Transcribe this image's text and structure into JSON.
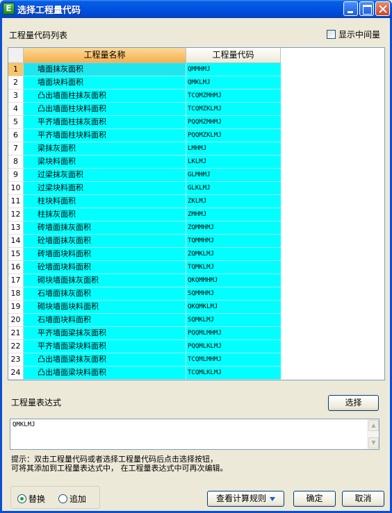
{
  "window": {
    "title": "选择工程量代码"
  },
  "list_label": "工程量代码列表",
  "show_intermediate_label": "显示中间量",
  "table": {
    "headers": {
      "name": "工程量名称",
      "code": "工程量代码"
    },
    "rows": [
      {
        "n": "1",
        "name": "墙面抹灰面积",
        "code": "QMMHMJ"
      },
      {
        "n": "2",
        "name": "墙面块料面积",
        "code": "QMKLMJ"
      },
      {
        "n": "3",
        "name": "凸出墙面柱抹灰面积",
        "code": "TCQMZMHMJ"
      },
      {
        "n": "4",
        "name": "凸出墙面柱块料面积",
        "code": "TCQMZKLMJ"
      },
      {
        "n": "5",
        "name": "平齐墙面柱抹灰面积",
        "code": "PQQMZMHMJ"
      },
      {
        "n": "6",
        "name": "平齐墙面柱块料面积",
        "code": "PQQMZKLMJ"
      },
      {
        "n": "7",
        "name": "梁抹灰面积",
        "code": "LMHMJ"
      },
      {
        "n": "8",
        "name": "梁块料面积",
        "code": "LKLMJ"
      },
      {
        "n": "9",
        "name": "过梁抹灰面积",
        "code": "GLMHMJ"
      },
      {
        "n": "10",
        "name": "过梁块料面积",
        "code": "GLKLMJ"
      },
      {
        "n": "11",
        "name": "柱块料面积",
        "code": "ZKLMJ"
      },
      {
        "n": "12",
        "name": "柱抹灰面积",
        "code": "ZMHMJ"
      },
      {
        "n": "13",
        "name": "砖墙面抹灰面积",
        "code": "ZQMMHMJ"
      },
      {
        "n": "14",
        "name": "砼墙面抹灰面积",
        "code": "TQMMHMJ"
      },
      {
        "n": "15",
        "name": "砖墙面块料面积",
        "code": "ZQMKLMJ"
      },
      {
        "n": "16",
        "name": "砼墙面块料面积",
        "code": "TQMKLMJ"
      },
      {
        "n": "17",
        "name": "砌块墙面抹灰面积",
        "code": "QKQMMHMJ"
      },
      {
        "n": "18",
        "name": "石墙面抹灰面积",
        "code": "SQMMHMJ"
      },
      {
        "n": "19",
        "name": "砌块墙面块料面积",
        "code": "QKQMKLMJ"
      },
      {
        "n": "20",
        "name": "石墙面块料面积",
        "code": "SQMKLMJ"
      },
      {
        "n": "21",
        "name": "平齐墙面梁抹灰面积",
        "code": "PQQMLMHMJ"
      },
      {
        "n": "22",
        "name": "平齐墙面梁块料面积",
        "code": "PQQMLKLMJ"
      },
      {
        "n": "23",
        "name": "凸出墙面梁抹灰面积",
        "code": "TCQMLMHMJ"
      },
      {
        "n": "24",
        "name": "凸出墙面梁块料面积",
        "code": "TCQMLKLMJ"
      }
    ]
  },
  "expression_label": "工程量表达式",
  "select_button": "选择",
  "expression_value": "QMKLMJ",
  "hint_line1": "提示：双击工程量代码或者选择工程量代码后点击选择按钮，",
  "hint_line2": "可将其添加到工程量表达式中， 在工程量表达式中可再次编辑。",
  "radio": {
    "replace": "替换",
    "append": "追加",
    "selected": "replace"
  },
  "rules_button": "查看计算规则",
  "ok_button": "确定",
  "cancel_button": "取消",
  "colors": {
    "row_bg": "#00ffff",
    "header_name_bg": "#f7b14d",
    "titlebar": "#0054e3"
  }
}
